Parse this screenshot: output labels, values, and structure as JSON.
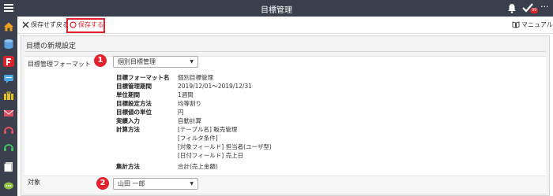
{
  "header": {
    "title": "目標管理",
    "badge_count": "99"
  },
  "toolbar": {
    "close_label": "保存せず戻る",
    "save_label": "保存する",
    "manual_label": "マニュアル"
  },
  "page": {
    "section_title": "目標の新規設定"
  },
  "form": {
    "format_label": "目標管理フォーマット",
    "format_value": "個別目標管理",
    "target_label": "対象",
    "target_value": "山田 一郎"
  },
  "markers": {
    "one": "1",
    "two": "2"
  },
  "details": [
    {
      "key": "目標フォーマット名",
      "value": "個別目標管理"
    },
    {
      "key": "目標管理期間",
      "value": "2019/12/01～2019/12/31"
    },
    {
      "key": "単位期間",
      "value": "1週間"
    },
    {
      "key": "目標設定方法",
      "value": "均等割り"
    },
    {
      "key": "目標値の単位",
      "value": "円"
    },
    {
      "key": "実績入力",
      "value": "自動計算"
    },
    {
      "key": "計算方法",
      "value": "[テーブル名] 販売管理"
    },
    {
      "key": "",
      "value": "[フィルタ条件]"
    },
    {
      "key": "",
      "value": "[対象フィールド] 担当者(ユーザ型)"
    },
    {
      "key": "",
      "value": "[日付フィールド] 売上日"
    },
    {
      "key": "集計方法",
      "value": "合計(売上金額)"
    }
  ],
  "sidebar_icons": [
    "home-icon",
    "database-icon",
    "flag-icon",
    "chat-icon",
    "briefcase-icon",
    "mail-icon",
    "headset-icon",
    "headset-green-icon",
    "document-icon",
    "message-icon"
  ],
  "colors": {
    "topbar": "#393f4c",
    "accent_red": "#e5212e"
  }
}
